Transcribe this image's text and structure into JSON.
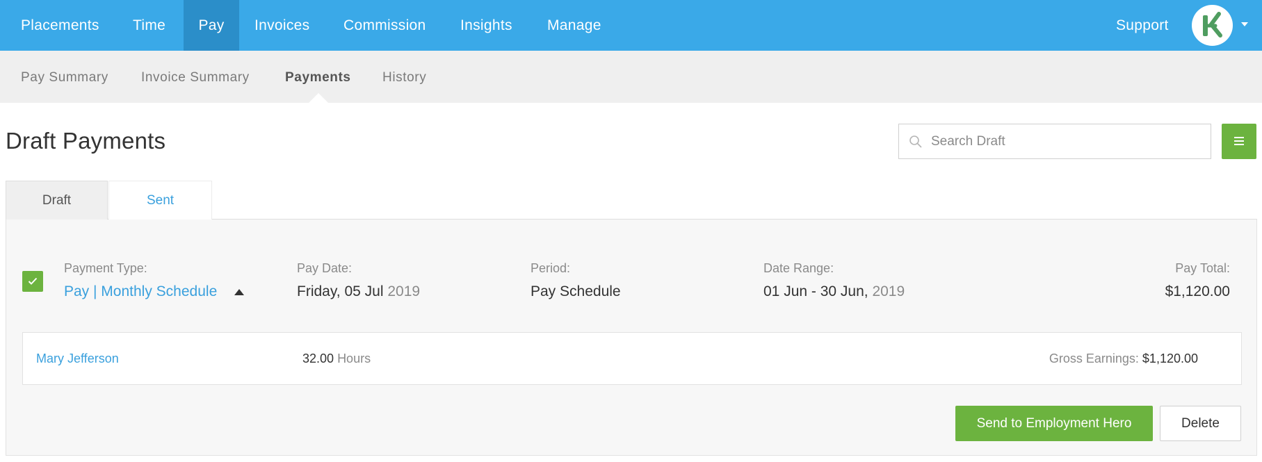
{
  "nav": {
    "items": [
      {
        "label": "Placements"
      },
      {
        "label": "Time"
      },
      {
        "label": "Pay",
        "active": true
      },
      {
        "label": "Invoices"
      },
      {
        "label": "Commission"
      },
      {
        "label": "Insights"
      },
      {
        "label": "Manage"
      }
    ],
    "support_label": "Support",
    "brand_color": "#3aa9e8",
    "active_color": "#2b8ec9"
  },
  "subnav": {
    "items": [
      {
        "label": "Pay Summary"
      },
      {
        "label": "Invoice Summary"
      },
      {
        "label": "Payments",
        "active": true
      },
      {
        "label": "History"
      }
    ]
  },
  "page": {
    "title": "Draft Payments",
    "search_placeholder": "Search Draft"
  },
  "tabs": [
    {
      "label": "Draft",
      "active": true
    },
    {
      "label": "Sent"
    }
  ],
  "payment": {
    "type_label": "Payment Type:",
    "type_value": "Pay | Monthly Schedule",
    "pay_date_label": "Pay Date:",
    "pay_date_main": "Friday, 05 Jul",
    "pay_date_year": "2019",
    "period_label": "Period:",
    "period_value": "Pay Schedule",
    "date_range_label": "Date Range:",
    "date_range_main": "01 Jun - 30 Jun,",
    "date_range_year": "2019",
    "total_label": "Pay Total:",
    "total_value": "$1,120.00",
    "checked": true
  },
  "employees": [
    {
      "name": "Mary Jefferson",
      "hours_value": "32.00",
      "hours_unit": "Hours",
      "gross_label": "Gross Earnings:",
      "gross_value": "$1,120.00"
    }
  ],
  "actions": {
    "send_label": "Send to Employment Hero",
    "delete_label": "Delete"
  },
  "colors": {
    "accent_green": "#6cb33f",
    "link_blue": "#3aa0dd"
  }
}
